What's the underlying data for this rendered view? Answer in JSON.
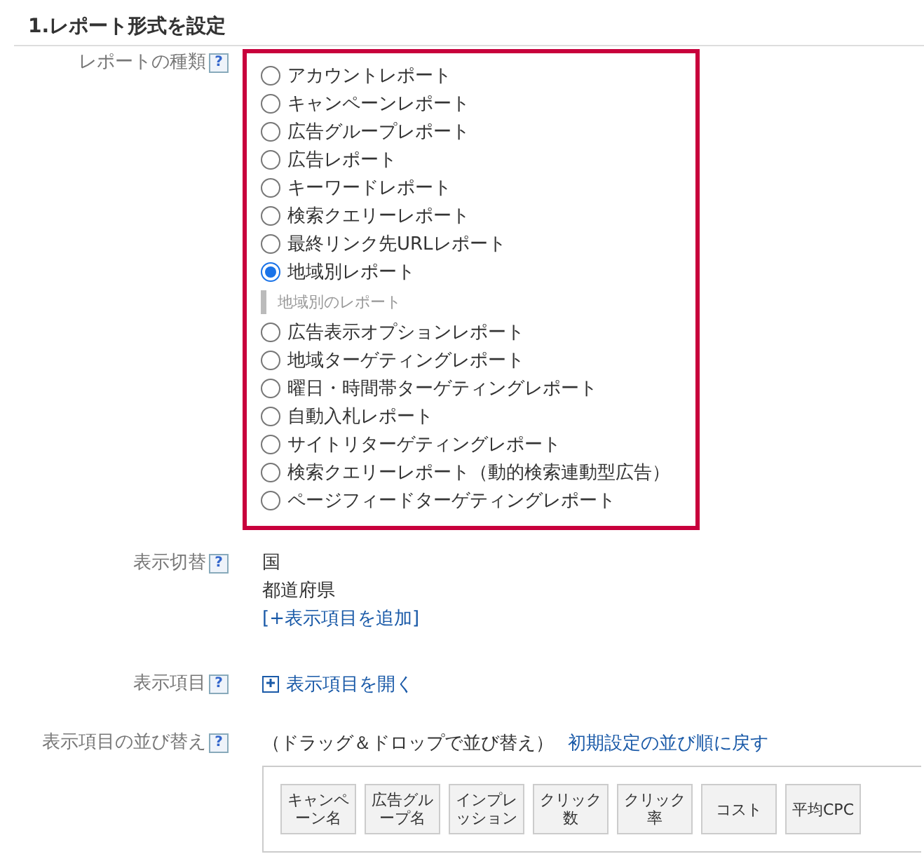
{
  "section_title": "1.レポート形式を設定",
  "report_type": {
    "label": "レポートの種類",
    "help": "?",
    "options": [
      {
        "kind": "radio",
        "label": "アカウントレポート",
        "selected": false
      },
      {
        "kind": "radio",
        "label": "キャンペーンレポート",
        "selected": false
      },
      {
        "kind": "radio",
        "label": "広告グループレポート",
        "selected": false
      },
      {
        "kind": "radio",
        "label": "広告レポート",
        "selected": false
      },
      {
        "kind": "radio",
        "label": "キーワードレポート",
        "selected": false
      },
      {
        "kind": "radio",
        "label": "検索クエリーレポート",
        "selected": false
      },
      {
        "kind": "radio",
        "label": "最終リンク先URLレポート",
        "selected": false
      },
      {
        "kind": "radio",
        "label": "地域別レポート",
        "selected": true
      },
      {
        "kind": "group_label",
        "label": "地域別のレポート"
      },
      {
        "kind": "radio",
        "label": "広告表示オプションレポート",
        "selected": false
      },
      {
        "kind": "radio",
        "label": "地域ターゲティングレポート",
        "selected": false
      },
      {
        "kind": "radio",
        "label": "曜日・時間帯ターゲティングレポート",
        "selected": false
      },
      {
        "kind": "radio",
        "label": "自動入札レポート",
        "selected": false
      },
      {
        "kind": "radio",
        "label": "サイトリターゲティングレポート",
        "selected": false
      },
      {
        "kind": "radio",
        "label": "検索クエリーレポート（動的検索連動型広告）",
        "selected": false
      },
      {
        "kind": "radio",
        "label": "ページフィードターゲティングレポート",
        "selected": false
      }
    ]
  },
  "display_switch": {
    "label": "表示切替",
    "help": "?",
    "values": [
      "国",
      "都道府県"
    ],
    "add_link": "[+表示項目を追加]"
  },
  "display_items": {
    "label": "表示項目",
    "help": "?",
    "open_link": "表示項目を開く"
  },
  "sort": {
    "label": "表示項目の並び替え",
    "help": "?",
    "note": "（ドラッグ＆ドロップで並び替え）",
    "reset_link": "初期設定の並び順に戻す",
    "chips": [
      "キャンペーン名",
      "広告グループ名",
      "インプレッション",
      "クリック数",
      "クリック率",
      "コスト",
      "平均CPC"
    ]
  }
}
